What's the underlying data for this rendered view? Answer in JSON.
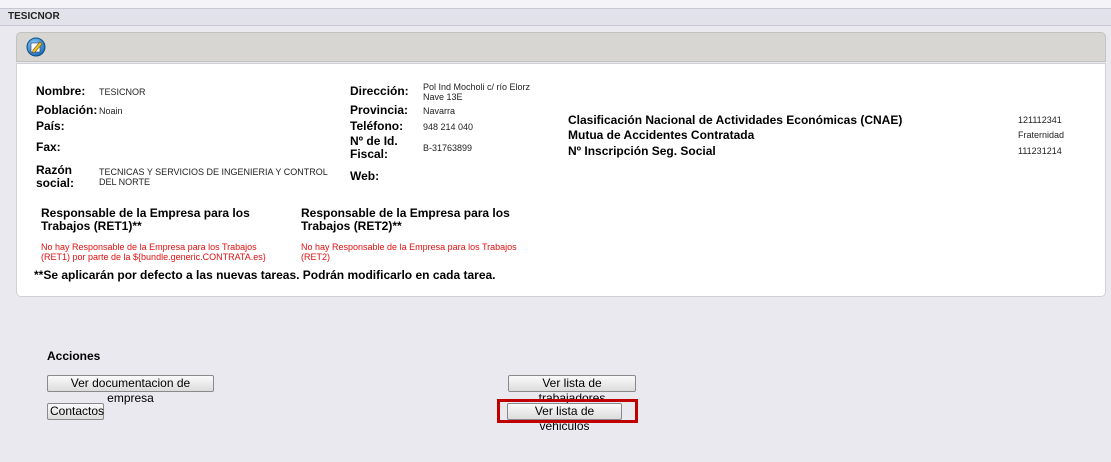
{
  "window": {
    "title": "TESICNOR"
  },
  "toolbar": {
    "edit_icon": "edit-pencil-icon"
  },
  "company": {
    "nombre_label": "Nombre:",
    "nombre": "TESICNOR",
    "poblacion_label": "Población:",
    "poblacion": "Noain",
    "pais_label": "País:",
    "pais": "",
    "fax_label": "Fax:",
    "fax": "",
    "razon_label_1": "Razón",
    "razon_label_2": "social:",
    "razon_line1": "TECNICAS Y SERVICIOS DE INGENIERIA Y CONTROL",
    "razon_line2": "DEL NORTE",
    "direccion_label": "Dirección:",
    "direccion_line1": "Pol Ind Mocholi c/ río Elorz",
    "direccion_line2": "Nave 13E",
    "provincia_label": "Provincia:",
    "provincia": "Navarra",
    "telefono_label": "Teléfono:",
    "telefono": "948 214 040",
    "idfiscal_label_1": "Nº de Id.",
    "idfiscal_label_2": "Fiscal:",
    "idfiscal": "B-31763899",
    "web_label": "Web:",
    "web": "",
    "cnae_label": "Clasificación Nacional de Actividades Económicas (CNAE)",
    "cnae": "121112341",
    "mutua_label": "Mutua de Accidentes Contratada",
    "mutua": "Fraternidad",
    "segsocial_label": "Nº Inscripción Seg. Social",
    "segsocial": "111231214"
  },
  "responsables": {
    "ret1_title_1": "Responsable de la Empresa para los",
    "ret1_title_2": "Trabajos (RET1)**",
    "ret1_msg_1": "No hay Responsable de la Empresa para los Trabajos",
    "ret1_msg_2": "(RET1) por parte de la ${bundle.generic.CONTRATA.es}",
    "ret2_title_1": "Responsable de la Empresa para los",
    "ret2_title_2": "Trabajos (RET2)**",
    "ret2_msg_1": "No hay Responsable de la Empresa para los Trabajos",
    "ret2_msg_2": "(RET2)",
    "footnote": "**Se aplicarán por defecto a las nuevas tareas. Podrán modificarlo en cada tarea."
  },
  "acciones": {
    "title": "Acciones",
    "ver_documentacion": "Ver documentacion de empresa",
    "contactos": "Contactos",
    "ver_trabajadores": "Ver lista de trabajadores",
    "ver_vehiculos": "Ver lista de vehiculos"
  },
  "colors": {
    "highlight": "#c00000",
    "warning_text": "#e01010"
  }
}
